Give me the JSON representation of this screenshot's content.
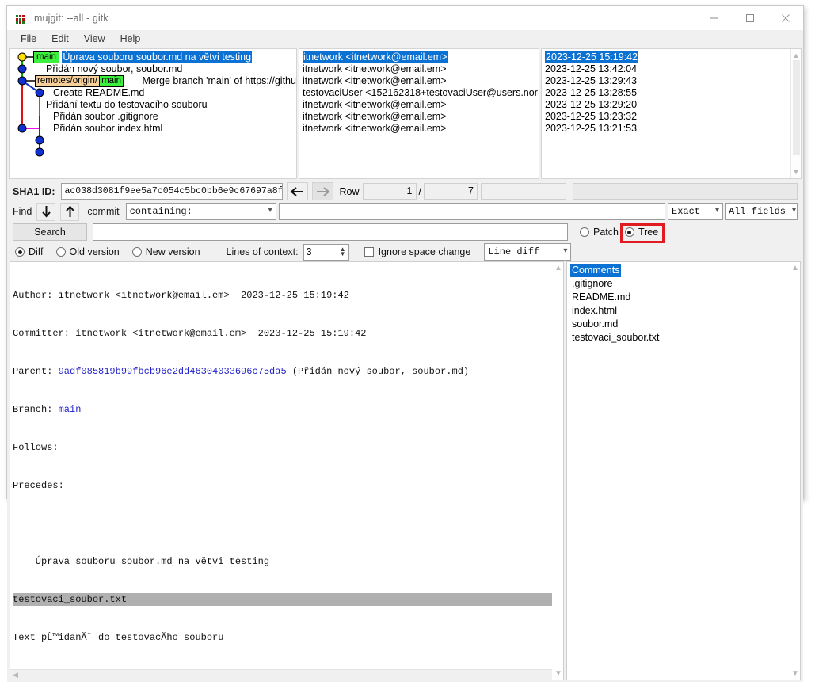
{
  "window": {
    "title": "mujgit: --all - gitk",
    "icon": "gitk-dots-icon",
    "minimize_label": "minimize-icon",
    "maximize_label": "maximize-icon",
    "close_label": "close-icon"
  },
  "menu": {
    "items": [
      {
        "label": "File"
      },
      {
        "label": "Edit"
      },
      {
        "label": "View"
      },
      {
        "label": "Help"
      }
    ]
  },
  "commits": [
    {
      "message": "Úprava souboru soubor.md na větvi testing",
      "selected": true,
      "refs": [
        {
          "text": "main",
          "type": "local"
        }
      ],
      "author": "itnetwork <itnetwork@email.em>",
      "date": "2023-12-25 15:19:42"
    },
    {
      "message": "Přidán nový soubor, soubor.md",
      "selected": false,
      "refs": [],
      "author": "itnetwork <itnetwork@email.em>",
      "date": "2023-12-25 13:42:04"
    },
    {
      "message": "Merge branch 'main' of https://github.",
      "selected": false,
      "refs": [
        {
          "text": "remotes/origin/",
          "text2": "main",
          "type": "remote"
        }
      ],
      "author": "itnetwork <itnetwork@email.em>",
      "date": "2023-12-25 13:29:43"
    },
    {
      "message": "Create README.md",
      "selected": false,
      "refs": [],
      "author": "testovaciUser <152162318+testovaciUser@users.nor",
      "date": "2023-12-25 13:28:55"
    },
    {
      "message": "Přidání textu do testovacího souboru",
      "selected": false,
      "refs": [],
      "author": "itnetwork <itnetwork@email.em>",
      "date": "2023-12-25 13:29:20"
    },
    {
      "message": "Přidán soubor .gitignore",
      "selected": false,
      "refs": [],
      "author": "itnetwork <itnetwork@email.em>",
      "date": "2023-12-25 13:23:32"
    },
    {
      "message": "Přidán soubor index.html",
      "selected": false,
      "refs": [],
      "author": "itnetwork <itnetwork@email.em>",
      "date": "2023-12-25 13:21:53"
    }
  ],
  "sha1_row": {
    "label": "SHA1 ID:",
    "value": "ac038d3081f9ee5a7c054c5bc0bb6e9c67697a8f",
    "back_icon": "arrow-left-icon",
    "forward_icon": "arrow-right-icon",
    "row_label": "Row",
    "row_current": "1",
    "separator": "/",
    "row_total": "7",
    "extra_value": ""
  },
  "find_row": {
    "label": "Find",
    "down_icon": "arrow-down-icon",
    "up_icon": "arrow-up-icon",
    "commit_label": "commit",
    "containing_value": "containing:",
    "query_value": "",
    "exact_value": "Exact",
    "fields_value": "All fields"
  },
  "search_row": {
    "search_label": "Search",
    "search_value": "",
    "patch_label": "Patch",
    "tree_label": "Tree",
    "selected_view": "Tree"
  },
  "options_row": {
    "diff_label": "Diff",
    "old_version_label": "Old version",
    "new_version_label": "New version",
    "selected_mode": "Diff",
    "lines_label": "Lines of context:",
    "lines_value": "3",
    "ignore_space_label": "Ignore space change",
    "ignore_space_checked": false,
    "diff_mode_value": "Line diff"
  },
  "diff": {
    "lines": [
      {
        "kind": "plain",
        "text": "Author: itnetwork <itnetwork@email.em>  2023-12-25 15:19:42"
      },
      {
        "kind": "plain",
        "text": "Committer: itnetwork <itnetwork@email.em>  2023-12-25 15:19:42"
      },
      {
        "kind": "parent",
        "prefix": "Parent: ",
        "link": "9adf085819b99fbcb96e2dd46304033696c75da5",
        "suffix": " (Přidán nový soubor, soubor.md)"
      },
      {
        "kind": "branch",
        "prefix": "Branch: ",
        "link": "main",
        "suffix": ""
      },
      {
        "kind": "plain",
        "text": "Follows:"
      },
      {
        "kind": "plain",
        "text": "Precedes:"
      },
      {
        "kind": "plain",
        "text": ""
      },
      {
        "kind": "plain",
        "text": "    Úprava souboru soubor.md na větvi testing"
      },
      {
        "kind": "file",
        "text": "testovaci_soubor.txt"
      },
      {
        "kind": "plain",
        "text": "Text pĹ™idanĂ˝ do testovacĂ­ho souboru"
      }
    ]
  },
  "tree": {
    "items": [
      {
        "label": "Comments",
        "selected": true
      },
      {
        "label": ".gitignore",
        "selected": false
      },
      {
        "label": "README.md",
        "selected": false
      },
      {
        "label": "index.html",
        "selected": false
      },
      {
        "label": "soubor.md",
        "selected": false
      },
      {
        "label": "testovaci_soubor.txt",
        "selected": false
      }
    ]
  },
  "colors": {
    "selection": "#0b72d4",
    "ref_local": "#3ef03e",
    "ref_remote": "#f7cf9b",
    "highlight_box": "#e01b22",
    "graph_head": "#ffe000",
    "graph_node": "#1030d0"
  }
}
